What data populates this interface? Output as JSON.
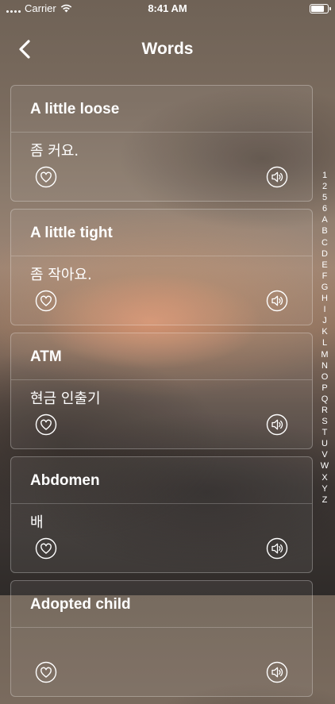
{
  "status_bar": {
    "carrier": "Carrier",
    "time": "8:41 AM",
    "battery_level": 0.85
  },
  "header": {
    "title": "Words"
  },
  "words": [
    {
      "word": "A little loose",
      "translation": "좀 커요."
    },
    {
      "word": "A little tight",
      "translation": "좀 작아요."
    },
    {
      "word": "ATM",
      "translation": "현금 인출기"
    },
    {
      "word": "Abdomen",
      "translation": "배"
    },
    {
      "word": "Adopted child",
      "translation": ""
    }
  ],
  "index_letters": [
    "1",
    "2",
    "5",
    "6",
    "A",
    "B",
    "C",
    "D",
    "E",
    "F",
    "G",
    "H",
    "I",
    "J",
    "K",
    "L",
    "M",
    "N",
    "O",
    "P",
    "Q",
    "R",
    "S",
    "T",
    "U",
    "V",
    "W",
    "X",
    "Y",
    "Z"
  ],
  "icons": {
    "back": "chevron-left-icon",
    "favorite": "heart-icon",
    "audio": "speaker-icon",
    "wifi": "wifi-icon",
    "battery": "battery-icon"
  }
}
